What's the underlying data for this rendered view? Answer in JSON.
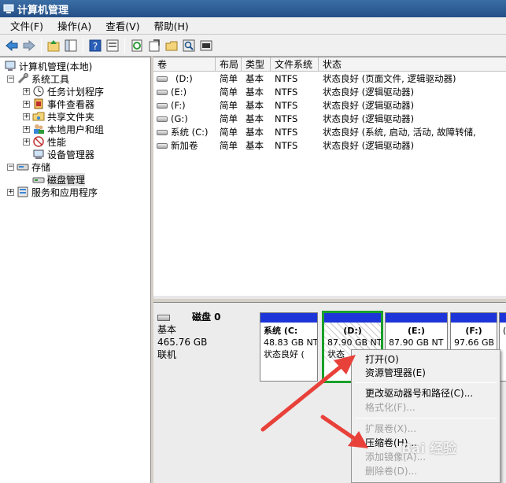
{
  "window": {
    "title": "计算机管理"
  },
  "menubar": [
    "文件(F)",
    "操作(A)",
    "查看(V)",
    "帮助(H)"
  ],
  "tree": {
    "root": "计算机管理(本地)",
    "items": [
      {
        "label": "系统工具",
        "level": 1,
        "expand": "−"
      },
      {
        "label": "任务计划程序",
        "level": 2,
        "expand": "+"
      },
      {
        "label": "事件查看器",
        "level": 2,
        "expand": "+"
      },
      {
        "label": "共享文件夹",
        "level": 2,
        "expand": "+"
      },
      {
        "label": "本地用户和组",
        "level": 2,
        "expand": "+"
      },
      {
        "label": "性能",
        "level": 2,
        "expand": "+"
      },
      {
        "label": "设备管理器",
        "level": 2,
        "expand": ""
      },
      {
        "label": "存储",
        "level": 1,
        "expand": "−"
      },
      {
        "label": "磁盘管理",
        "level": 2,
        "expand": ""
      },
      {
        "label": "服务和应用程序",
        "level": 1,
        "expand": "+"
      }
    ]
  },
  "volume_list": {
    "headers": [
      "卷",
      "布局",
      "类型",
      "文件系统",
      "状态"
    ],
    "rows": [
      {
        "volume": "(D:)",
        "layout": "简单",
        "type": "基本",
        "fs": "NTFS",
        "status": "状态良好 (页面文件, 逻辑驱动器)"
      },
      {
        "volume": "(E:)",
        "layout": "简单",
        "type": "基本",
        "fs": "NTFS",
        "status": "状态良好 (逻辑驱动器)"
      },
      {
        "volume": "(F:)",
        "layout": "简单",
        "type": "基本",
        "fs": "NTFS",
        "status": "状态良好 (逻辑驱动器)"
      },
      {
        "volume": "(G:)",
        "layout": "简单",
        "type": "基本",
        "fs": "NTFS",
        "status": "状态良好 (逻辑驱动器)"
      },
      {
        "volume": "系统 (C:)",
        "layout": "简单",
        "type": "基本",
        "fs": "NTFS",
        "status": "状态良好 (系统, 启动, 活动, 故障转储,"
      },
      {
        "volume": "新加卷",
        "layout": "简单",
        "type": "基本",
        "fs": "NTFS",
        "status": "状态良好 (逻辑驱动器)"
      }
    ]
  },
  "disk": {
    "name": "磁盘 0",
    "type": "基本",
    "size": "465.76 GB",
    "state": "联机",
    "partitions": [
      {
        "name": "系统  (C:",
        "size": "48.83 GB NT",
        "status": "状态良好 (",
        "selected": false
      },
      {
        "name": "(D:)",
        "size": "87.90 GB NT",
        "status": "状态",
        "selected": true
      },
      {
        "name": "(E:)",
        "size": "87.90 GB NT",
        "status": "",
        "selected": false
      },
      {
        "name": "(F:)",
        "size": "97.66 GB NT",
        "status": "",
        "selected": false
      },
      {
        "name": "",
        "size": "",
        "status": "(",
        "selected": false
      }
    ]
  },
  "context_menu": {
    "items": [
      {
        "label": "打开(O)",
        "enabled": true
      },
      {
        "label": "资源管理器(E)",
        "enabled": true
      },
      {
        "label": "更改驱动器号和路径(C)...",
        "enabled": true
      },
      {
        "label": "格式化(F)...",
        "enabled": false
      },
      {
        "label": "扩展卷(X)...",
        "enabled": false
      },
      {
        "label": "压缩卷(H)...",
        "enabled": true
      },
      {
        "label": "添加镜像(A)...",
        "enabled": false
      },
      {
        "label": "删除卷(D)...",
        "enabled": false
      }
    ]
  },
  "watermark": "Bai 经验",
  "colors": {
    "accent_bar": "#1d35d8",
    "selection_border": "#1aa02a",
    "arrow": "#e8413a"
  },
  "icons": [
    "back-icon",
    "forward-icon",
    "up-icon",
    "show-hide-tree-icon",
    "help-icon",
    "properties-icon",
    "refresh-icon",
    "export-icon",
    "open-icon",
    "search-icon",
    "settings-icon"
  ]
}
